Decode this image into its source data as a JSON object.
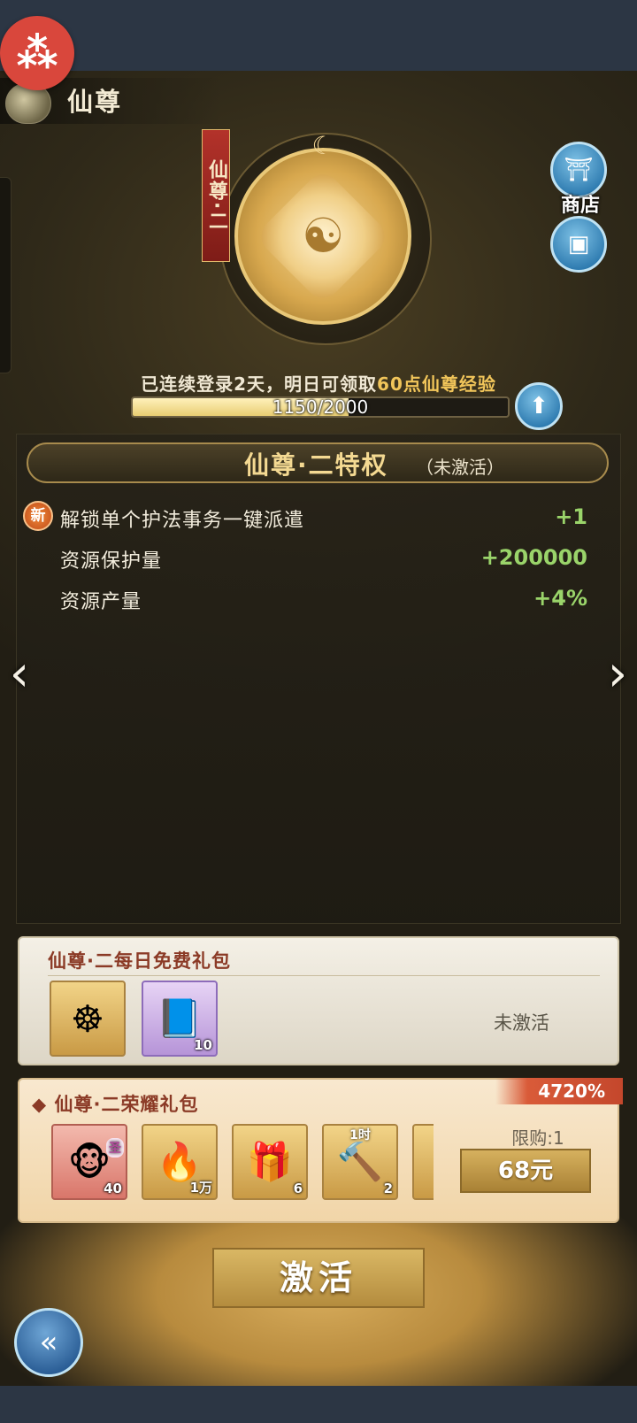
{
  "header": {
    "title": "仙尊"
  },
  "medallion": {
    "rank_label": "仙尊·二"
  },
  "side_buttons": {
    "shop_label": "商店"
  },
  "login": {
    "prefix": "已连续登录2天，明日可领取",
    "highlight": "60点仙尊经验",
    "progress_text": "1150/2000",
    "progress_value": 1150,
    "progress_max": 2000
  },
  "privileges": {
    "title": "仙尊·二特权",
    "status": "（未激活）",
    "new_badge": "新",
    "perks": [
      {
        "label": "解锁单个护法事务一键派遣",
        "value": "+1"
      },
      {
        "label": "资源保护量",
        "value": "+200000"
      },
      {
        "label": "资源产量",
        "value": "+4%"
      }
    ]
  },
  "free_pack": {
    "title": "仙尊·二每日免费礼包",
    "status": "未激活",
    "items": [
      {
        "icon": "meditating-figure-icon",
        "qty": ""
      },
      {
        "icon": "purple-book-icon",
        "qty": "10"
      }
    ]
  },
  "honor_pack": {
    "title": "仙尊·二荣耀礼包",
    "bonus_ribbon": "4720%",
    "limit": "限购:1",
    "price": "68元",
    "items": [
      {
        "icon": "monkey-king-icon",
        "badge": "圣",
        "qty": "40"
      },
      {
        "icon": "flame-orb-icon",
        "qty": "1万"
      },
      {
        "icon": "treasure-chest-icon",
        "qty": "6"
      },
      {
        "icon": "speedup-hammer-icon",
        "timer": "1时",
        "qty": "2"
      },
      {
        "icon": "partial-item-icon",
        "qty": ""
      }
    ]
  },
  "activate_button": "激活",
  "colors": {
    "highlight_gold": "#f1c55a",
    "perk_green": "#9ad46a",
    "title_red": "#8b3a26"
  }
}
